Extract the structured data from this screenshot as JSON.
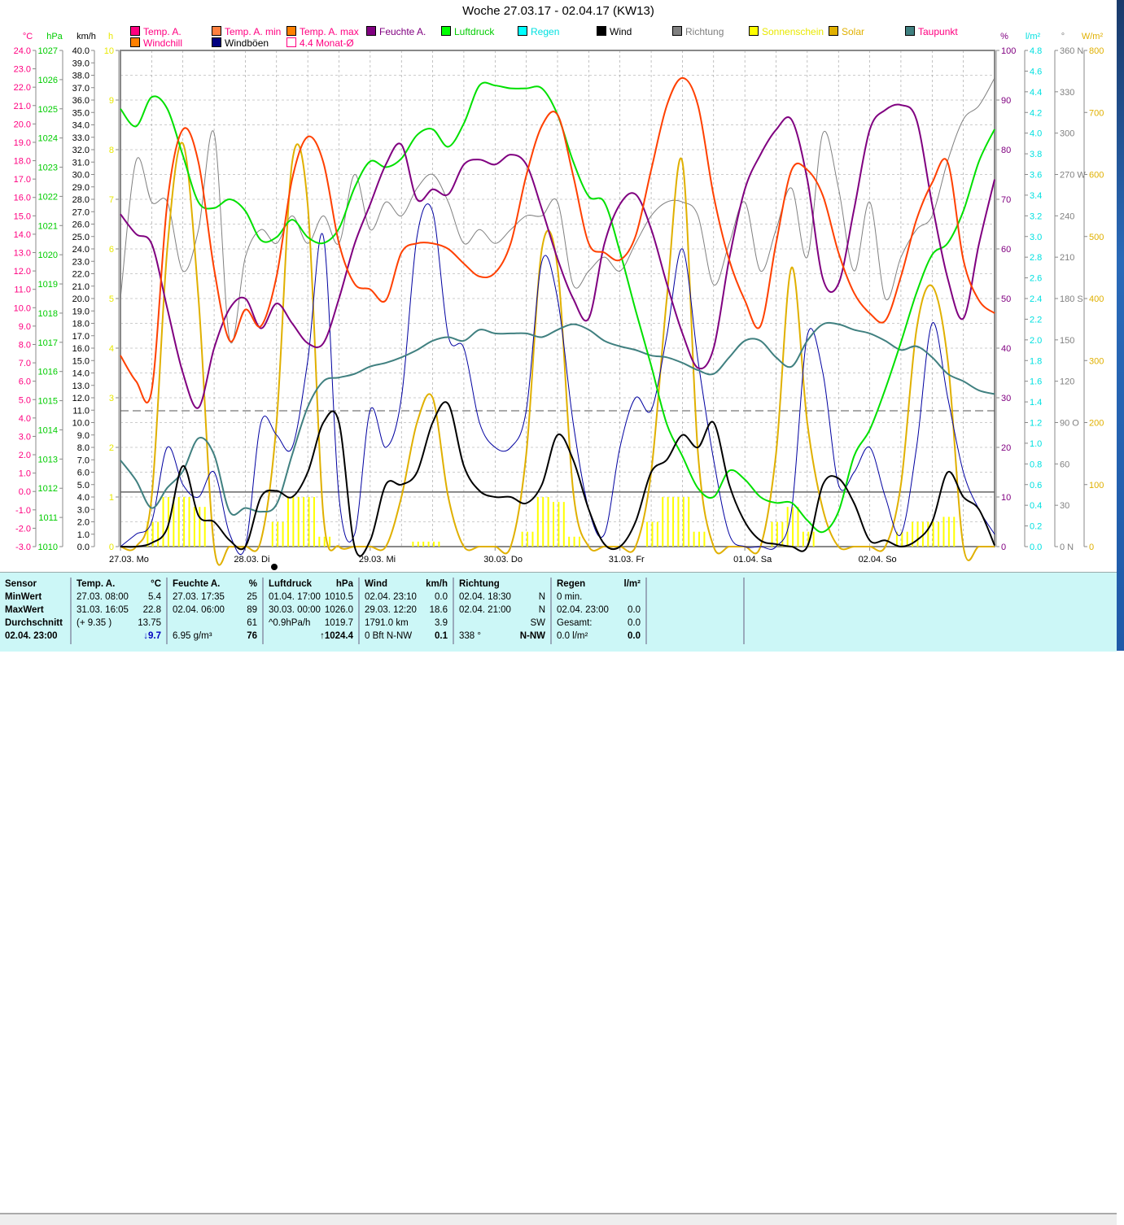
{
  "title": "Woche 27.03.17 - 02.04.17 (KW13)",
  "legend": [
    {
      "label": "Temp. A.",
      "color": "#ff0080",
      "text": "#ff0080"
    },
    {
      "label": "Temp. A. min",
      "color": "#ff8040",
      "text": "#ff0080"
    },
    {
      "label": "Temp. A. max",
      "color": "#ff8000",
      "text": "#ff0080"
    },
    {
      "label": "Feuchte A.",
      "color": "#800080",
      "text": "#800080"
    },
    {
      "label": "Luftdruck",
      "color": "#00ff00",
      "text": "#00cc00"
    },
    {
      "label": "Regen",
      "color": "#00ffff",
      "text": "#00e0e0"
    },
    {
      "label": "Wind",
      "color": "#000000",
      "text": "#000000"
    },
    {
      "label": "Richtung",
      "color": "#808080",
      "text": "#808080"
    },
    {
      "label": "Sonnenschein",
      "color": "#ffff00",
      "text": "#e8e800"
    },
    {
      "label": "Solar",
      "color": "#e0b000",
      "text": "#e0b000"
    },
    {
      "label": "Taupunkt",
      "color": "#408080",
      "text": "#ff0080"
    },
    {
      "label": "Windchill",
      "color": "#ff8000",
      "text": "#ff0080"
    },
    {
      "label": "Windböen",
      "color": "#000080",
      "text": "#000000"
    },
    {
      "label": "4.4 Monat-Ø",
      "color": "#ffffff",
      "text": "#ff0080"
    }
  ],
  "chart_data": {
    "type": "line",
    "title": "Woche 27.03.17 - 02.04.17 (KW13)",
    "x_interval_hours": 3,
    "x_labels": [
      "27.03.  Mo",
      "28.03.  Di",
      "29.03.  Mi",
      "30.03.  Do",
      "31.03.  Fr",
      "01.04.  Sa",
      "02.04.  So"
    ],
    "axes": {
      "temp": {
        "unit": "°C",
        "min": -3,
        "max": 24,
        "step": 1,
        "color": "#ff0080"
      },
      "pressure": {
        "unit": "hPa",
        "min": 1010,
        "max": 1027,
        "step": 1,
        "color": "#00cc00"
      },
      "wind": {
        "unit": "km/h",
        "min": 0,
        "max": 40,
        "step": 1,
        "color": "#000000"
      },
      "sun": {
        "unit": "h",
        "min": 0,
        "max": 10,
        "step": 1,
        "color": "#e8e800"
      },
      "humidity": {
        "unit": "%",
        "min": 0,
        "max": 100,
        "step": 10,
        "color": "#800080"
      },
      "rain": {
        "unit": "l/m²",
        "min": 0,
        "max": 4.8,
        "step": 0.2,
        "color": "#00e0e0"
      },
      "direction": {
        "unit": "°",
        "min": 0,
        "max": 360,
        "step": 30,
        "color": "#808080",
        "compass": {
          "0": "N",
          "90": "O",
          "180": "S",
          "270": "W",
          "360": "N"
        }
      },
      "solar": {
        "unit": "W/m²",
        "min": 0,
        "max": 800,
        "step": 100,
        "color": "#e0b000"
      }
    },
    "reference_line": {
      "label": "4.4 Monat-Ø",
      "axis": "wind",
      "value": 4.4
    },
    "series": [
      {
        "name": "Sonnenschein",
        "axis": "sun",
        "kind": "bars",
        "color": "#ffff00",
        "values": [
          0,
          0,
          0.5,
          1,
          1,
          0.8,
          0,
          0,
          0,
          0,
          0.5,
          1,
          1,
          0.2,
          0,
          0,
          0,
          0,
          0,
          0.1,
          0.1,
          0,
          0,
          0,
          0,
          0,
          0.3,
          1,
          0.9,
          0.2,
          0,
          0,
          0,
          0,
          0.5,
          1,
          1,
          0.3,
          0,
          0,
          0,
          0,
          0.5,
          0.8,
          0.3,
          0,
          0,
          0,
          0,
          0,
          0.3,
          0.5,
          0.5,
          0.6,
          0,
          0,
          0
        ]
      },
      {
        "name": "Richtung",
        "axis": "direction",
        "color": "#808080",
        "width": 1,
        "values": [
          180,
          280,
          250,
          250,
          200,
          230,
          300,
          150,
          210,
          230,
          220,
          240,
          220,
          240,
          220,
          270,
          230,
          250,
          240,
          260,
          270,
          250,
          220,
          230,
          220,
          230,
          240,
          240,
          250,
          190,
          200,
          210,
          200,
          220,
          240,
          250,
          250,
          240,
          190,
          220,
          250,
          200,
          230,
          260,
          210,
          300,
          260,
          200,
          250,
          180,
          210,
          230,
          240,
          280,
          310,
          320,
          340
        ]
      },
      {
        "name": "Solar",
        "axis": "solar",
        "color": "#e0b000",
        "width": 2,
        "values": [
          0,
          0,
          80,
          480,
          650,
          400,
          0,
          0,
          0,
          10,
          200,
          620,
          550,
          50,
          0,
          0,
          0,
          0,
          80,
          200,
          240,
          80,
          0,
          0,
          0,
          0,
          150,
          480,
          450,
          90,
          0,
          0,
          0,
          0,
          120,
          400,
          620,
          150,
          0,
          0,
          0,
          0,
          150,
          450,
          200,
          60,
          0,
          0,
          0,
          0,
          100,
          350,
          420,
          300,
          0,
          0,
          0
        ]
      },
      {
        "name": "Windböen",
        "axis": "wind",
        "color": "#0000a0",
        "width": 1,
        "values": [
          0,
          1,
          2,
          8,
          5,
          4,
          6,
          1,
          0,
          10,
          9,
          8,
          15,
          25,
          4,
          1,
          11,
          8,
          12,
          25,
          27,
          17,
          16,
          10,
          8,
          8,
          11,
          23,
          20,
          10,
          3,
          1,
          8,
          12,
          11,
          17,
          24,
          15,
          7,
          1,
          0,
          0,
          0,
          3,
          17,
          14,
          5,
          6,
          8,
          4,
          1,
          8,
          18,
          12,
          6,
          3,
          1
        ]
      },
      {
        "name": "Taupunkt",
        "axis": "temp",
        "color": "#408080",
        "width": 2,
        "values": [
          1.7,
          0.6,
          -0.9,
          0.2,
          1.1,
          2.9,
          2,
          -1.1,
          -0.9,
          -1.1,
          -0.7,
          2,
          4.6,
          6,
          6.2,
          6.4,
          6.8,
          7,
          7.3,
          7.7,
          8.2,
          8.4,
          8.2,
          8.8,
          8.6,
          8.6,
          8.6,
          8.4,
          8.8,
          9.1,
          8.8,
          8.2,
          7.9,
          7.7,
          7.4,
          7.3,
          7,
          6.6,
          6.4,
          7.3,
          8.2,
          8.2,
          7.3,
          6.8,
          8.2,
          9.1,
          9.1,
          8.8,
          8.6,
          8.2,
          7.7,
          7.9,
          7.3,
          6.4,
          6,
          5.5,
          5.3
        ]
      },
      {
        "name": "Luftdruck",
        "axis": "pressure",
        "color": "#00e000",
        "width": 2,
        "values": [
          1025,
          1024.4,
          1025.4,
          1025,
          1023.4,
          1021.8,
          1021.6,
          1021.9,
          1021.5,
          1020.5,
          1020.6,
          1021.2,
          1020.6,
          1020.4,
          1020.9,
          1022.3,
          1023.2,
          1023,
          1023.3,
          1024.1,
          1024.3,
          1023.7,
          1024.5,
          1025.8,
          1025.8,
          1025.7,
          1025.7,
          1025.7,
          1024.8,
          1023.2,
          1022,
          1021.8,
          1020.1,
          1018.1,
          1016.2,
          1014.2,
          1013.1,
          1012,
          1011.7,
          1012.6,
          1012.3,
          1011.7,
          1011.5,
          1011.5,
          1010.9,
          1010.5,
          1011.2,
          1013.1,
          1014,
          1015.4,
          1017,
          1018.7,
          1020,
          1020.4,
          1021.5,
          1023.2,
          1024.3
        ]
      },
      {
        "name": "Feuchte A.",
        "axis": "humidity",
        "color": "#800080",
        "width": 2,
        "values": [
          67,
          63,
          61,
          48,
          35,
          28,
          40,
          48,
          50,
          44,
          49,
          45,
          41,
          41,
          50,
          61,
          69,
          77,
          81,
          70,
          72,
          71,
          77,
          78,
          77,
          79,
          77,
          68,
          58,
          50,
          46,
          61,
          69,
          71,
          64,
          53,
          43,
          36,
          40,
          58,
          72,
          79,
          84,
          86,
          74,
          54,
          53,
          68,
          84,
          88,
          89,
          86,
          69,
          54,
          46,
          61,
          74
        ]
      },
      {
        "name": "Temp. A.",
        "axis": "temp",
        "color": "#ff4000",
        "width": 2,
        "values": [
          7.4,
          6,
          5.5,
          15.7,
          19.7,
          17.9,
          12.1,
          8.2,
          9.9,
          9,
          11.7,
          17,
          19.3,
          17.9,
          13.5,
          11.3,
          11,
          10.4,
          13,
          13.5,
          13.5,
          13.2,
          12.4,
          11.7,
          11.9,
          13.5,
          17.2,
          19.9,
          20.5,
          17.2,
          13.5,
          13,
          12.6,
          13.9,
          17.5,
          21,
          22.5,
          21,
          16.1,
          12.6,
          10.4,
          9,
          13.5,
          17.5,
          17.5,
          16.1,
          13,
          10.8,
          9.7,
          9.3,
          11.7,
          14.8,
          16.8,
          17.9,
          12.6,
          10.4,
          9.7
        ]
      },
      {
        "name": "Wind",
        "axis": "wind",
        "color": "#000000",
        "width": 2,
        "values": [
          0,
          0,
          0.3,
          1.5,
          6.5,
          2.5,
          2,
          0.5,
          0,
          4,
          4.5,
          4,
          6,
          10,
          10,
          0,
          0.5,
          5,
          5,
          6,
          10,
          11.5,
          6.5,
          4.5,
          4,
          4,
          3.5,
          5,
          9,
          7,
          3,
          0.2,
          0,
          2,
          6,
          7,
          9,
          8,
          10,
          5,
          2,
          0.5,
          0.2,
          0,
          0,
          5,
          5.5,
          3.5,
          0.5,
          0.5,
          0,
          0.5,
          2,
          6,
          4,
          3,
          0.1
        ]
      }
    ]
  },
  "stats": {
    "sensor": {
      "header": "Sensor",
      "rows": [
        "MinWert",
        "MaxWert",
        "Durchschnitt",
        "02.04.  23:00"
      ]
    },
    "columns": [
      {
        "header": "Temp. A.",
        "unit": "°C",
        "rows": [
          [
            "27.03.  08:00",
            "5.4"
          ],
          [
            "31.03.  16:05",
            "22.8"
          ],
          [
            "(+ 9.35 )",
            "13.75"
          ],
          [
            "",
            "↓9.7"
          ]
        ]
      },
      {
        "header": "Feuchte A.",
        "unit": "%",
        "rows": [
          [
            "27.03.  17:35",
            "25"
          ],
          [
            "02.04.  06:00",
            "89"
          ],
          [
            "",
            "61"
          ],
          [
            "6.95 g/m³",
            "76"
          ]
        ]
      },
      {
        "header": "Luftdruck",
        "unit": "hPa",
        "rows": [
          [
            "01.04.  17:00",
            "1010.5"
          ],
          [
            "30.03.  00:00",
            "1026.0"
          ],
          [
            "^0.9hPa/h",
            "1019.7"
          ],
          [
            "",
            "↑1024.4"
          ]
        ]
      },
      {
        "header": "Wind",
        "unit": "km/h",
        "rows": [
          [
            "02.04.  23:10",
            "0.0"
          ],
          [
            "29.03.  12:20",
            "18.6"
          ],
          [
            "1791.0 km",
            "3.9"
          ],
          [
            "0 Bft N-NW",
            "0.1"
          ]
        ]
      },
      {
        "header": "Richtung",
        "unit": "",
        "rows": [
          [
            "02.04.  18:30",
            "N"
          ],
          [
            "02.04.  21:00",
            "N"
          ],
          [
            "",
            "SW"
          ],
          [
            "338 °",
            "N-NW"
          ]
        ]
      },
      {
        "header": "Regen",
        "unit": "l/m²",
        "rows": [
          [
            "0 min.",
            ""
          ],
          [
            "02.04.  23:00",
            "0.0"
          ],
          [
            "Gesamt:",
            "0.0"
          ],
          [
            "0.0 l/m²",
            "0.0"
          ]
        ]
      }
    ]
  }
}
